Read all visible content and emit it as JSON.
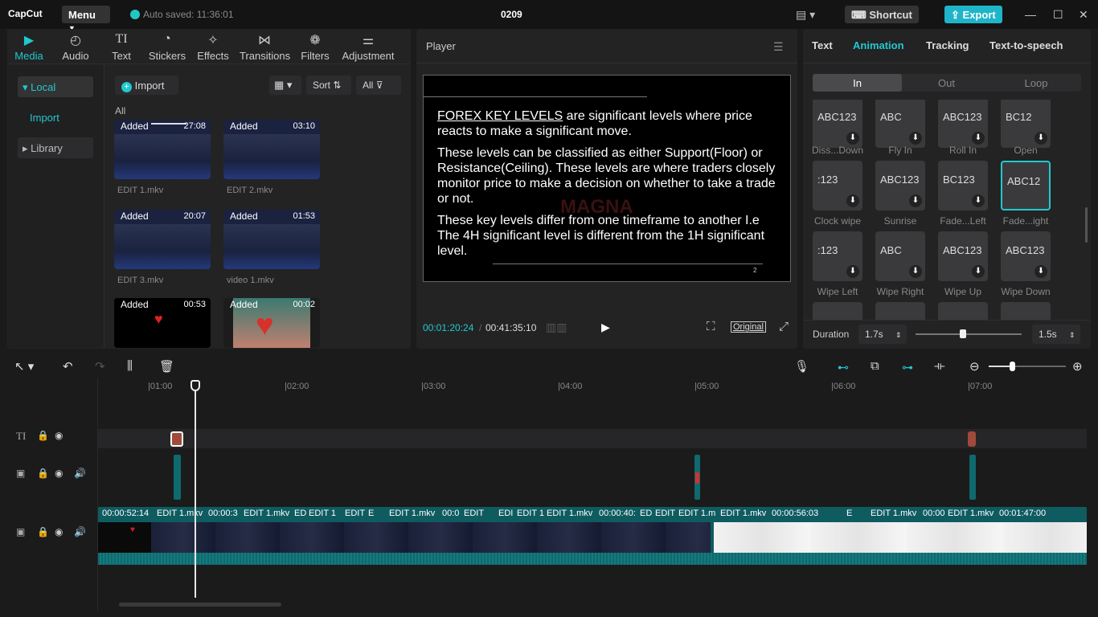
{
  "app": {
    "logo": "CapCut",
    "menu_label": "Menu",
    "autosave": "Auto saved: 11:36:01",
    "project_title": "0209",
    "shortcut_label": "Shortcut",
    "export_label": "Export"
  },
  "media_panel": {
    "tabs": [
      "Media",
      "Audio",
      "Text",
      "Stickers",
      "Effects",
      "Transitions",
      "Filters",
      "Adjustment"
    ],
    "active_tab": "Media",
    "side": {
      "local": "Local",
      "import": "Import",
      "library": "Library"
    },
    "import_label": "Import",
    "sort_label": "Sort",
    "filter_label": "All",
    "all_header": "All",
    "items": [
      {
        "badge": "Added",
        "duration": "27:08",
        "name": "EDIT 1.mkv"
      },
      {
        "badge": "Added",
        "duration": "03:10",
        "name": "EDIT 2.mkv"
      },
      {
        "badge": "Added",
        "duration": "20:07",
        "name": "EDIT 3.mkv"
      },
      {
        "badge": "Added",
        "duration": "01:53",
        "name": "video 1.mkv"
      },
      {
        "badge": "Added",
        "duration": "00:53",
        "name": ""
      },
      {
        "badge": "Added",
        "duration": "00:02",
        "name": ""
      }
    ]
  },
  "player": {
    "title": "Player",
    "paragraph1_link": "FOREX KEY LEVELS",
    "paragraph1_rest": " are significant levels where price reacts to make a significant move.",
    "paragraph2": "These levels can be classified as either Support(Floor) or Resistance(Ceiling). These levels are where traders closely monitor price to make a decision on whether to take a trade or not.",
    "paragraph3": "These key levels differ from one timeframe to another I.e The 4H significant level is different from the 1H significant level.",
    "watermark": "MAGNA",
    "page_number": "2",
    "current_time": "00:01:20:24",
    "total_time": "00:41:35:10",
    "original_label": "Original"
  },
  "right_panel": {
    "tabs": [
      "Text",
      "Animation",
      "Tracking",
      "Text-to-speech"
    ],
    "active_tab": "Animation",
    "segments": [
      "In",
      "Out",
      "Loop"
    ],
    "active_segment": "In",
    "animations": [
      {
        "thumb": "ABC123",
        "label": "Diss...Down"
      },
      {
        "thumb": "ABC",
        "label": "Fly In"
      },
      {
        "thumb": "ABC123",
        "label": "Roll In"
      },
      {
        "thumb": "BC12",
        "label": "Open"
      },
      {
        "thumb": ":123",
        "label": "Clock wipe"
      },
      {
        "thumb": "ABC123",
        "label": "Sunrise"
      },
      {
        "thumb": "BC123",
        "label": "Fade...Left"
      },
      {
        "thumb": "ABC12",
        "label": "Fade...ight"
      },
      {
        "thumb": ":123",
        "label": "Wipe Left"
      },
      {
        "thumb": "ABC",
        "label": "Wipe Right"
      },
      {
        "thumb": "ABC123",
        "label": "Wipe Up"
      },
      {
        "thumb": "ABC123",
        "label": "Wipe Down"
      }
    ],
    "duration_label": "Duration",
    "duration_value": "1.7s",
    "duration_max": "1.5s"
  },
  "timeline": {
    "ruler": [
      "|01:00",
      "|02:00",
      "|03:00",
      "|04:00",
      "|05:00",
      "|06:00",
      "|07:00"
    ],
    "clips": [
      {
        "label": "00:00:52:14"
      },
      {
        "label": "EDIT 1.mkv"
      },
      {
        "label": "00:00:3"
      },
      {
        "label": "EDIT 1.mkv"
      },
      {
        "label": "ED"
      },
      {
        "label": "EDIT 1"
      },
      {
        "label": "EDIT"
      },
      {
        "label": "E"
      },
      {
        "label": "EDIT 1.mkv"
      },
      {
        "label": "00:0"
      },
      {
        "label": "EDIT"
      },
      {
        "label": "EDI"
      },
      {
        "label": "EDIT 1"
      },
      {
        "label": "EDIT 1.mkv"
      },
      {
        "label": "00:00:40:"
      },
      {
        "label": "ED"
      },
      {
        "label": "EDIT"
      },
      {
        "label": "EDIT 1.m"
      },
      {
        "label": "EDIT 1.mkv"
      },
      {
        "label": "00:00:56:03"
      },
      {
        "label": "E"
      },
      {
        "label": "EDIT 1.mkv"
      },
      {
        "label": "00:00"
      },
      {
        "label": "EDIT 1.mkv"
      },
      {
        "label": "00:01:47:00"
      }
    ]
  },
  "colors": {
    "accent": "#22c8d0",
    "export": "#1fb5c8",
    "track": "#0e6a6e"
  }
}
